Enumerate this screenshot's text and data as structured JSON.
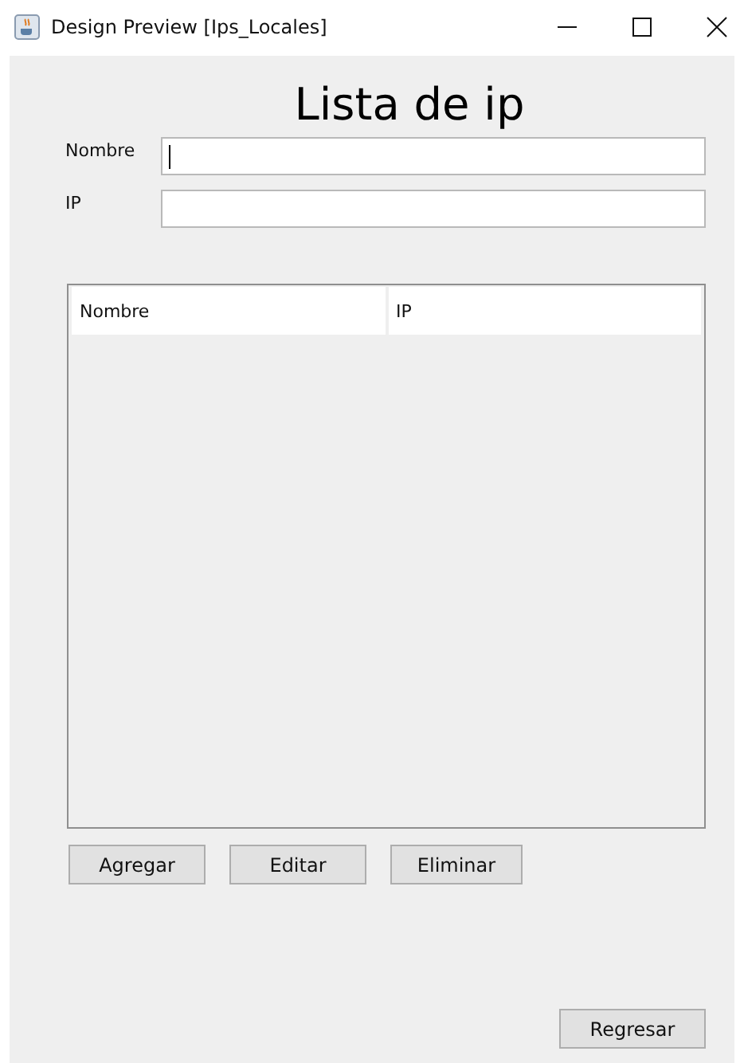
{
  "window": {
    "title": "Design Preview [Ips_Locales]"
  },
  "heading": "Lista de ip",
  "fields": [
    {
      "label": "Nombre",
      "focused": true
    },
    {
      "label": "IP",
      "focused": false
    }
  ],
  "table": {
    "columns": [
      "Nombre",
      "IP"
    ]
  },
  "actions": [
    "Agregar",
    "Editar",
    "Eliminar"
  ],
  "back_button": "Regresar"
}
